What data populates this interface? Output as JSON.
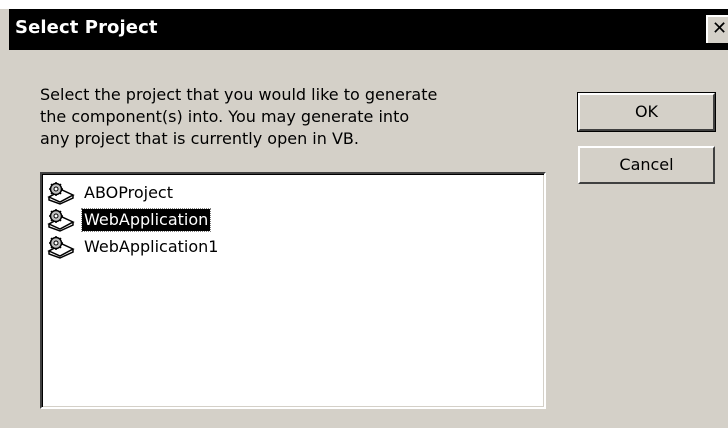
{
  "dialog": {
    "title": "Select Project",
    "close_glyph": "✕",
    "instructions": "Select the project that you would like to generate\nthe component(s) into. You may generate into\nany project that is currently open in VB.",
    "ok_label": "OK",
    "cancel_label": "Cancel"
  },
  "projects": [
    {
      "label": "ABOProject",
      "icon": "vb-project-icon",
      "selected": false
    },
    {
      "label": "WebApplication",
      "icon": "vb-project-icon",
      "selected": true
    },
    {
      "label": "WebApplication1",
      "icon": "vb-project-icon",
      "selected": false
    }
  ],
  "colors": {
    "titlebar": "#000000",
    "dialog_bg": "#d4d0c8",
    "list_bg": "#ffffff",
    "selection": "#000000"
  }
}
